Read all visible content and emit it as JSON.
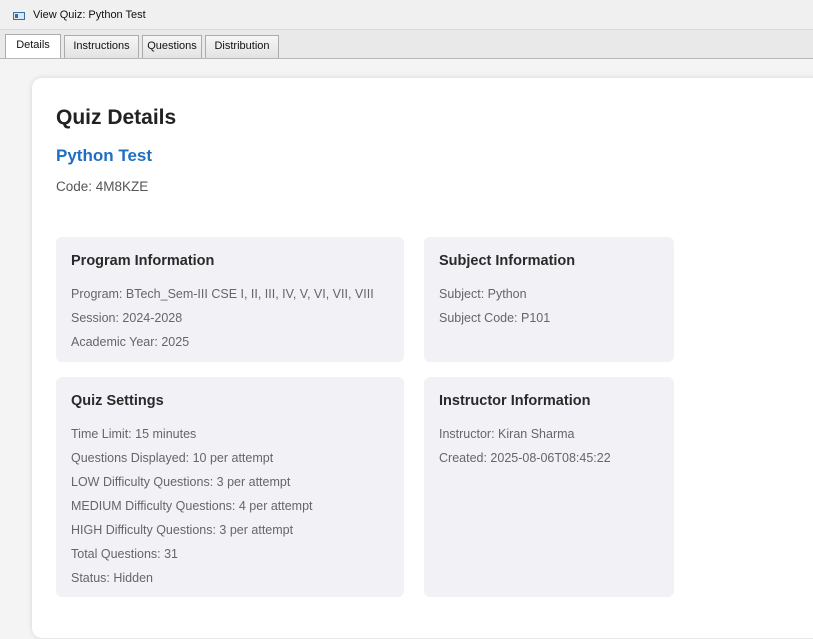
{
  "window": {
    "title": "View Quiz: Python Test"
  },
  "tabs": [
    {
      "label": "Details"
    },
    {
      "label": "Instructions"
    },
    {
      "label": "Questions"
    },
    {
      "label": "Distribution"
    }
  ],
  "details": {
    "heading": "Quiz Details",
    "quiz_name": "Python Test",
    "code": "Code: 4M8KZE",
    "program": {
      "title": "Program Information",
      "lines": [
        "Program: BTech_Sem-III CSE I, II, III, IV, V, VI, VII, VIII",
        "Session: 2024-2028",
        "Academic Year: 2025"
      ]
    },
    "subject": {
      "title": "Subject Information",
      "lines": [
        "Subject: Python",
        "Subject Code: P101"
      ]
    },
    "settings": {
      "title": "Quiz Settings",
      "lines": [
        "Time Limit: 15 minutes",
        "Questions Displayed: 10 per attempt",
        "LOW Difficulty Questions: 3 per attempt",
        "MEDIUM Difficulty Questions: 4 per attempt",
        "HIGH Difficulty Questions: 3 per attempt",
        "Total Questions: 31",
        "Status: Hidden"
      ]
    },
    "instructor": {
      "title": "Instructor Information",
      "lines": [
        "Instructor: Kiran Sharma",
        "Created: 2025-08-06T08:45:22"
      ]
    }
  },
  "colors": {
    "accent": "#1f6fc1",
    "box_bg": "#f2f2f6"
  }
}
